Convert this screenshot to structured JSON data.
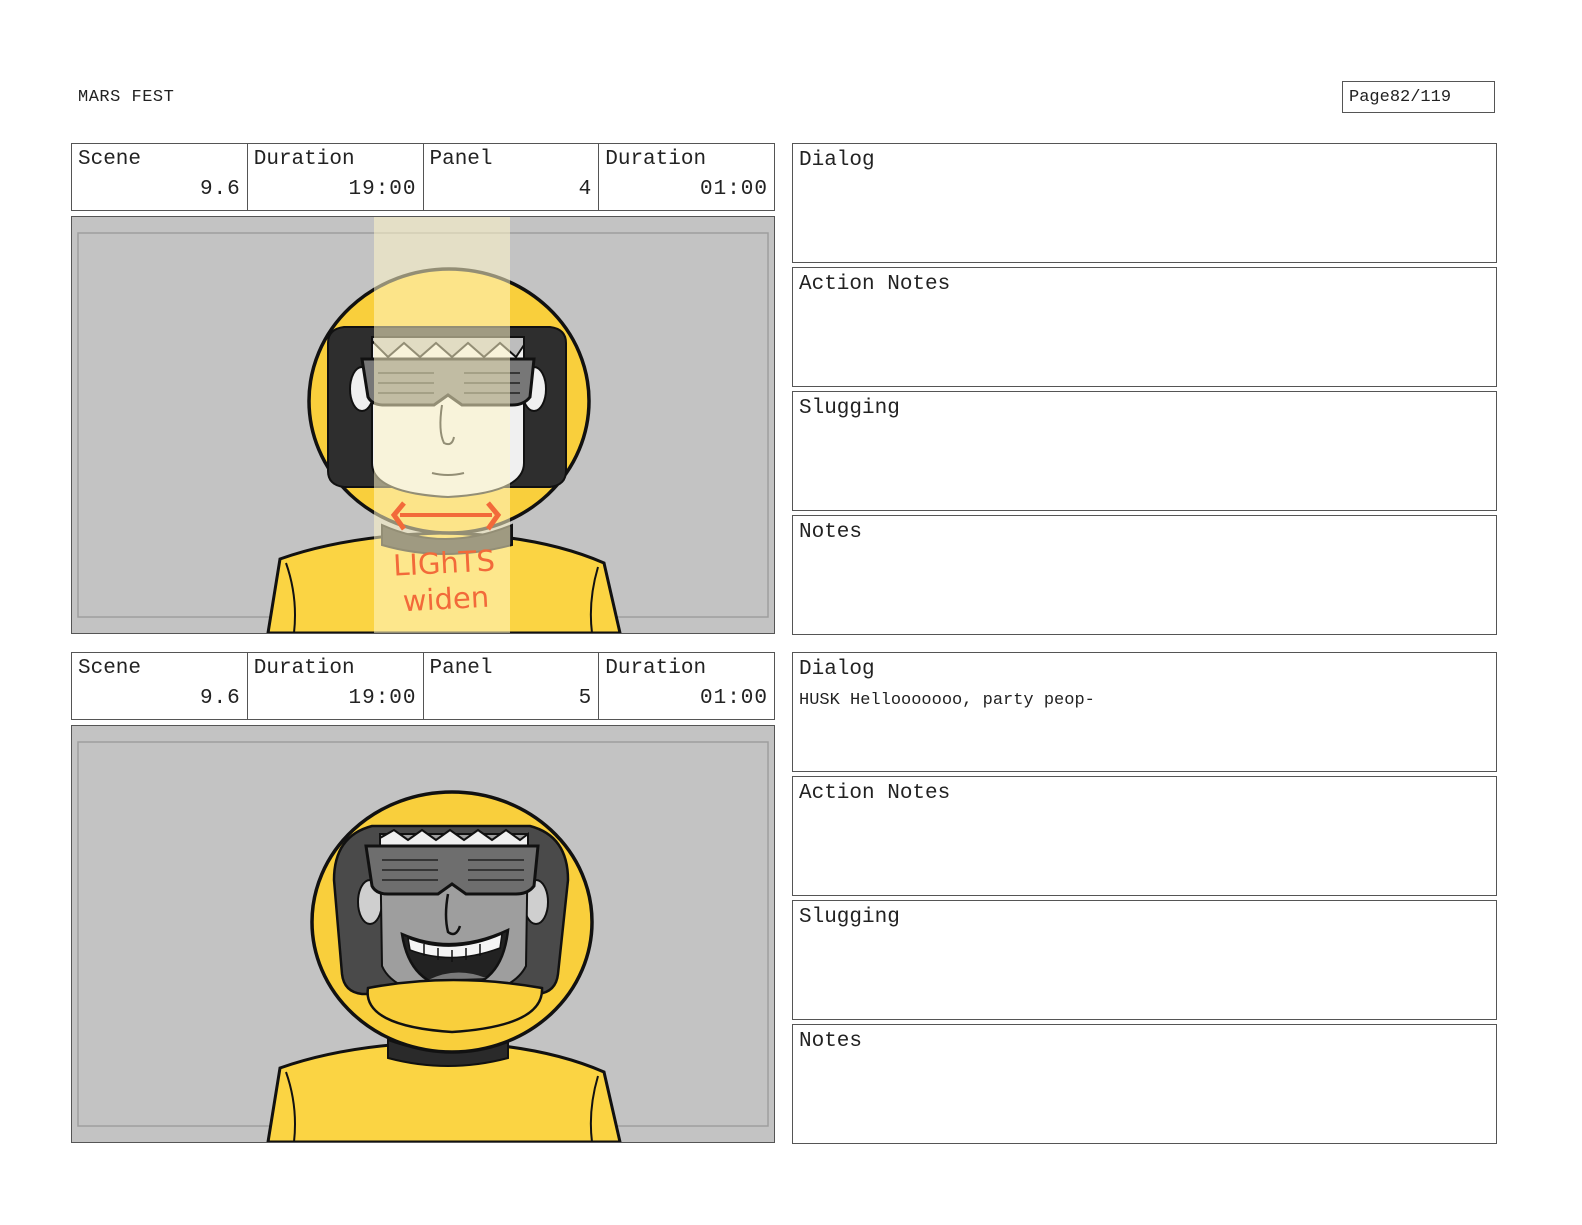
{
  "document": {
    "title": "MARS FEST",
    "page_label": "Page",
    "page_number": "82/119"
  },
  "labels": {
    "scene": "Scene",
    "duration": "Duration",
    "panel": "Panel",
    "dialog": "Dialog",
    "action_notes": "Action Notes",
    "slugging": "Slugging",
    "notes": "Notes"
  },
  "panels": [
    {
      "scene": "9.6",
      "scene_duration": "19:00",
      "panel": "4",
      "panel_duration": "01:00",
      "dialog": "",
      "action_notes": "",
      "slugging": "",
      "notes": "",
      "sketch_annotation": "LIGhTS widen"
    },
    {
      "scene": "9.6",
      "scene_duration": "19:00",
      "panel": "5",
      "panel_duration": "01:00",
      "dialog": "HUSK Hellooooooo, party peop-",
      "action_notes": "",
      "slugging": "",
      "notes": ""
    }
  ],
  "colors": {
    "backdrop": "#c3c3c3",
    "helmet": "#f9cf3c",
    "suit": "#fbd443",
    "visor": "#2e2e2e",
    "annotation": "#f26a3a",
    "light_beam": "#fff6c8"
  }
}
